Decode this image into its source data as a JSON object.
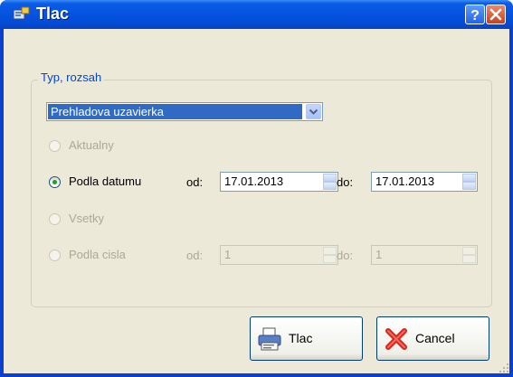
{
  "window": {
    "title": "Tlac"
  },
  "group": {
    "label": "Typ, rozsah"
  },
  "combo": {
    "value": "Prehladova uzavierka"
  },
  "options": {
    "aktualny": "Aktualny",
    "podla_datumu": "Podla datumu",
    "vsetky": "Vsetky",
    "podla_cisla": "Podla cisla"
  },
  "labels": {
    "od": "od:",
    "do": "do:"
  },
  "dates": {
    "from": "17.01.2013",
    "to": "17.01.2013"
  },
  "numbers": {
    "from": "1",
    "to": "1"
  },
  "buttons": {
    "print": "Tlac",
    "cancel": "Cancel"
  }
}
